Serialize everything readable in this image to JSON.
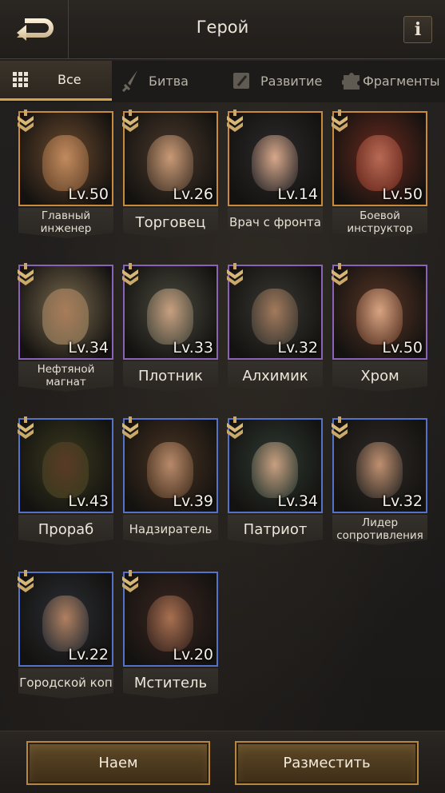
{
  "header": {
    "title": "Герой",
    "info_label": "i"
  },
  "tabs": [
    {
      "label": "Все",
      "icon": "grid-icon",
      "active": true
    },
    {
      "label": "Битва",
      "icon": "dagger-icon",
      "active": false
    },
    {
      "label": "Развитие",
      "icon": "hammer-icon",
      "active": false
    },
    {
      "label": "Фрагменты",
      "icon": "puzzle-icon",
      "active": false
    }
  ],
  "heroes": [
    {
      "name": "Главный инженер",
      "name_lines": [
        "Главный",
        "инженер"
      ],
      "level": "Lv.50",
      "rarity": "gold"
    },
    {
      "name": "Торговец",
      "name_lines": [
        "Торговец"
      ],
      "level": "Lv.26",
      "rarity": "gold"
    },
    {
      "name": "Врач с фронта",
      "name_lines": [
        "Врач с фронта"
      ],
      "level": "Lv.14",
      "rarity": "gold"
    },
    {
      "name": "Боевой инструктор",
      "name_lines": [
        "Боевой",
        "инструктор"
      ],
      "level": "Lv.50",
      "rarity": "gold"
    },
    {
      "name": "Нефтяной магнат",
      "name_lines": [
        "Нефтяной",
        "магнат"
      ],
      "level": "Lv.34",
      "rarity": "purple"
    },
    {
      "name": "Плотник",
      "name_lines": [
        "Плотник"
      ],
      "level": "Lv.33",
      "rarity": "purple"
    },
    {
      "name": "Алхимик",
      "name_lines": [
        "Алхимик"
      ],
      "level": "Lv.32",
      "rarity": "purple"
    },
    {
      "name": "Хром",
      "name_lines": [
        "Хром"
      ],
      "level": "Lv.50",
      "rarity": "purple"
    },
    {
      "name": "Прораб",
      "name_lines": [
        "Прораб"
      ],
      "level": "Lv.43",
      "rarity": "blue"
    },
    {
      "name": "Надзиратель",
      "name_lines": [
        "Надзиратель"
      ],
      "level": "Lv.39",
      "rarity": "blue"
    },
    {
      "name": "Патриот",
      "name_lines": [
        "Патриот"
      ],
      "level": "Lv.34",
      "rarity": "blue"
    },
    {
      "name": "Лидер сопротивления",
      "name_lines": [
        "Лидер",
        "сопротивления"
      ],
      "level": "Lv.32",
      "rarity": "blue"
    },
    {
      "name": "Городской коп",
      "name_lines": [
        "Городской коп"
      ],
      "level": "Lv.22",
      "rarity": "blue"
    },
    {
      "name": "Мститель",
      "name_lines": [
        "Мститель"
      ],
      "level": "Lv.20",
      "rarity": "blue"
    }
  ],
  "footer": {
    "recruit_label": "Наем",
    "deploy_label": "Разместить"
  },
  "colors": {
    "accent": "#d7a34a",
    "gold": "#c98a3c",
    "purple": "#8a63b8",
    "blue": "#5572c8"
  }
}
